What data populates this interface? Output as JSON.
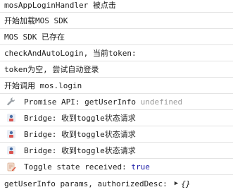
{
  "console": {
    "lines": [
      {
        "text": "mosAppLoginHandler 被点击"
      },
      {
        "text": "开始加载MOS SDK"
      },
      {
        "text": "MOS SDK 已存在"
      },
      {
        "text": "checkAndAutoLogin, 当前token:"
      },
      {
        "text": "token为空, 尝试自动登录"
      },
      {
        "text": "开始调用 mos.login"
      }
    ],
    "promise_line": {
      "icon": "wrench-icon",
      "text": "Promise API: getUserInfo",
      "value": "undefined"
    },
    "bridge_lines": [
      {
        "icon": "bridge-app-icon",
        "text": "Bridge: 收到toggle状态请求"
      },
      {
        "icon": "bridge-app-icon",
        "text": "Bridge: 收到toggle状态请求"
      },
      {
        "icon": "bridge-app-icon",
        "text": "Bridge: 收到toggle状态请求"
      }
    ],
    "toggle_line": {
      "icon": "edit-note-icon",
      "text": "Toggle state received:",
      "value": "true"
    },
    "params_line": {
      "text": "getUserInfo params, authorizedDesc:",
      "arrow": "▶",
      "object": "{}"
    }
  },
  "colors": {
    "text": "#222222",
    "muted": "#9a9a9a",
    "keyword": "#1a1aa6",
    "divider": "#e4e4e4",
    "background": "#ffffff"
  }
}
